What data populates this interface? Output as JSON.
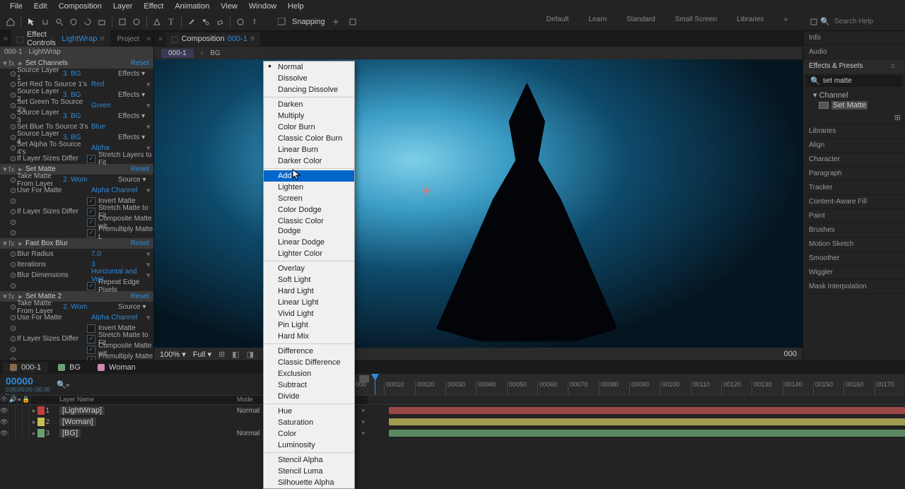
{
  "menubar": [
    "File",
    "Edit",
    "Composition",
    "Layer",
    "Effect",
    "Animation",
    "View",
    "Window",
    "Help"
  ],
  "toolbar": {
    "snapping_label": "Snapping",
    "workspaces": [
      "Default",
      "Learn",
      "Standard",
      "Small Screen",
      "Libraries"
    ],
    "search_placeholder": "Search Help"
  },
  "effect_controls": {
    "tab_label": "Effect Controls",
    "tab_layer": "LightWrap",
    "project_tab": "Project",
    "header": "000-1 · LightWrap",
    "reset_label": "Reset",
    "effects_dd": "Effects",
    "source_dd": "Source",
    "effects": [
      {
        "name": "Set Channels",
        "props": [
          {
            "l": "Source Layer 1",
            "v": "3. BG",
            "dd": "Effects"
          },
          {
            "l": "Set Red To Source 1's",
            "v": "Red"
          },
          {
            "l": "Source Layer 2",
            "v": "3. BG",
            "dd": "Effects"
          },
          {
            "l": "Set Green To Source 2's",
            "v": "Green"
          },
          {
            "l": "Source Layer 3",
            "v": "3. BG",
            "dd": "Effects"
          },
          {
            "l": "Set Blue To Source 3's",
            "v": "Blue"
          },
          {
            "l": "Source Layer 4",
            "v": "3. BG",
            "dd": "Effects"
          },
          {
            "l": "Set Alpha To Source 4's",
            "v": "Alpha"
          },
          {
            "l": "If Layer Sizes Differ",
            "cb": true,
            "cbl": "Stretch Layers to Fit"
          }
        ]
      },
      {
        "name": "Set Matte",
        "props": [
          {
            "l": "Take Matte From Layer",
            "v": "2. Wom",
            "dd": "Source"
          },
          {
            "l": "Use For Matte",
            "v": "Alpha Channel"
          },
          {
            "l": "",
            "cb": true,
            "cbl": "Invert Matte"
          },
          {
            "l": "If Layer Sizes Differ",
            "cb": true,
            "cbl": "Stretch Matte to Fit"
          },
          {
            "l": "",
            "cb": true,
            "cbl": "Composite Matte wit"
          },
          {
            "l": "",
            "cb": true,
            "cbl": "Premultiply Matte L"
          }
        ]
      },
      {
        "name": "Fast Box Blur",
        "props": [
          {
            "l": "Blur Radius",
            "v": "7.0"
          },
          {
            "l": "Iterations",
            "v": "3"
          },
          {
            "l": "Blur Dimensions",
            "v": "Horizontal and Vert"
          },
          {
            "l": "",
            "cb": true,
            "cbl": "Repeat Edge Pixels"
          }
        ]
      },
      {
        "name": "Set Matte 2",
        "props": [
          {
            "l": "Take Matte From Layer",
            "v": "2. Wom",
            "dd": "Source"
          },
          {
            "l": "Use For Matte",
            "v": "Alpha Channel"
          },
          {
            "l": "",
            "cb": false,
            "cbl": "Invert Matte"
          },
          {
            "l": "If Layer Sizes Differ",
            "cb": true,
            "cbl": "Stretch Matte to Fit"
          },
          {
            "l": "",
            "cb": true,
            "cbl": "Composite Matte wit"
          },
          {
            "l": "",
            "cb": true,
            "cbl": "Premultiply Matte L"
          }
        ]
      }
    ]
  },
  "comp": {
    "tab_prefix": "Composition",
    "tab_id": "000-1",
    "crumb": "000-1",
    "crumb2": "BG",
    "footer_zoom": "100%",
    "footer_res": "Full",
    "footer_time": "000"
  },
  "right": {
    "panels": [
      "Info",
      "Audio",
      "Effects & Presets",
      "Libraries",
      "Align",
      "Character",
      "Paragraph",
      "Tracker",
      "Content-Aware Fill",
      "Paint",
      "Brushes",
      "Motion Sketch",
      "Smoother",
      "Wiggler",
      "Mask Interpolation"
    ],
    "ep_search": "set matte",
    "ep_tree_parent": "Channel",
    "ep_tree_leaf": "Set Matte"
  },
  "blend_modes": {
    "groups": [
      [
        "Normal",
        "Dissolve",
        "Dancing Dissolve"
      ],
      [
        "Darken",
        "Multiply",
        "Color Burn",
        "Classic Color Burn",
        "Linear Burn",
        "Darker Color"
      ],
      [
        "Add",
        "Lighten",
        "Screen",
        "Color Dodge",
        "Classic Color Dodge",
        "Linear Dodge",
        "Lighter Color"
      ],
      [
        "Overlay",
        "Soft Light",
        "Hard Light",
        "Linear Light",
        "Vivid Light",
        "Pin Light",
        "Hard Mix"
      ],
      [
        "Difference",
        "Classic Difference",
        "Exclusion",
        "Subtract",
        "Divide"
      ],
      [
        "Hue",
        "Saturation",
        "Color",
        "Luminosity"
      ],
      [
        "Stencil Alpha",
        "Stencil Luma",
        "Silhouette Alpha"
      ]
    ],
    "checked": "Normal",
    "selected": "Add"
  },
  "timeline": {
    "tabs": [
      {
        "label": "000-1",
        "color": "#8a6a4a"
      },
      {
        "label": "BG",
        "color": "#6aa070"
      },
      {
        "label": "Woman",
        "color": "#d088b0"
      }
    ],
    "timecode": "00000",
    "col_name": "Layer Name",
    "col_mode": "Mode",
    "ticks": [
      "000",
      "00010",
      "00020",
      "00030",
      "00040",
      "00050",
      "00060",
      "00070",
      "00080",
      "00090",
      "00100",
      "00110",
      "00120",
      "00130",
      "00140",
      "00150",
      "00160",
      "00170"
    ],
    "layers": [
      {
        "idx": 1,
        "name": "[LightWrap]",
        "color": "#c04040",
        "mode": "Normal",
        "bar": "#9a4848"
      },
      {
        "idx": 2,
        "name": "[Woman]",
        "color": "#c8c050",
        "mode": "",
        "bar": "#a09a50"
      },
      {
        "idx": 3,
        "name": "[BG]",
        "color": "#6aa070",
        "mode": "Normal",
        "bar": "#5a8a60"
      }
    ]
  }
}
